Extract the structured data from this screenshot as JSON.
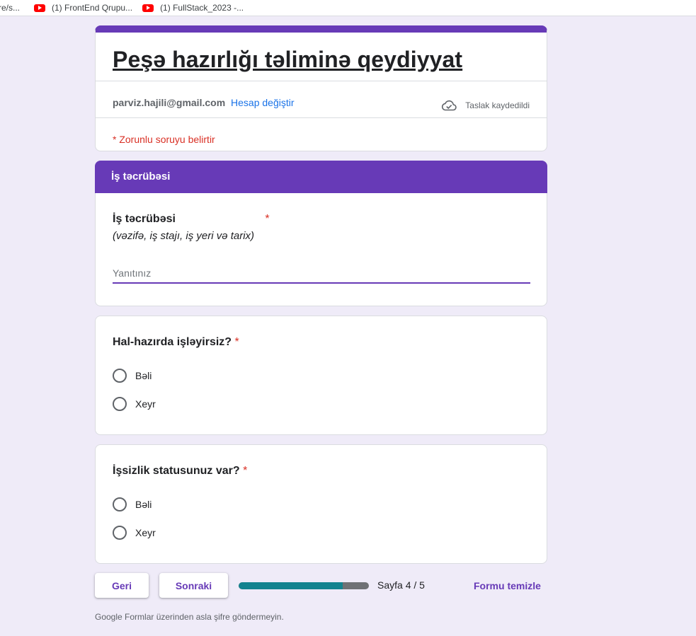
{
  "bookmarks": [
    {
      "label": "re/s..."
    },
    {
      "label": "(1) FrontEnd Qrupu...",
      "icon": "youtube-icon"
    },
    {
      "label": "(1) FullStack_2023 -...",
      "icon": "youtube-icon"
    }
  ],
  "form": {
    "title": "Peşə hazırlığı təliminə qeydiyyat",
    "account_email": "parviz.hajili@gmail.com",
    "switch_account": "Hesap değiştir",
    "draft_status": "Taslak kaydedildi",
    "required_note": "* Zorunlu soruyu belirtir"
  },
  "section": {
    "title": "İş təcrübəsi"
  },
  "questions": [
    {
      "title": "İş təcrübəsi",
      "required_mark": "*",
      "description": "(vəzifə, iş stajı, iş yeri və tarix)",
      "placeholder": "Yanıtınız"
    },
    {
      "title": "Hal-hazırda işləyirsiz?",
      "required_mark": "*",
      "options": [
        "Bəli",
        "Xeyr"
      ]
    },
    {
      "title": "İşsizlik statusunuz var?",
      "required_mark": "*",
      "options": [
        "Bəli",
        "Xeyr"
      ]
    }
  ],
  "navigation": {
    "back_label": "Geri",
    "next_label": "Sonraki",
    "page_text": "Sayfa 4 / 5",
    "progress": 0.8,
    "clear_label": "Formu temizle"
  },
  "footer": {
    "note": "Google Formlar üzerinden asla şifre göndermeyin."
  },
  "colors": {
    "accent": "#673ab7",
    "background": "#efebf8",
    "progress_fill": "#13838f",
    "progress_track": "#6f7175",
    "required": "#d93025",
    "link": "#1a73e8"
  }
}
